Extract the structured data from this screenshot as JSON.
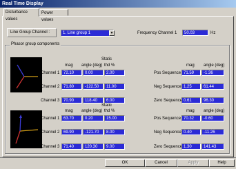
{
  "window": {
    "title": "Real Time Display"
  },
  "tabs": [
    {
      "label": "Disturbance values",
      "active": true
    },
    {
      "label": "Power values",
      "active": false
    }
  ],
  "line_group": {
    "label": "Line Group Channel :",
    "selected": "1. Line group 1"
  },
  "frequency": {
    "label": "Frequency Channel 1",
    "value": "50.03",
    "unit": "Hz"
  },
  "phasor_group": {
    "title": "Phasor group components",
    "upper": {
      "static_label": "Static",
      "headers": {
        "mag": "mag",
        "angle": "angle (deg)",
        "thd": "thd %"
      },
      "seq_headers": {
        "mag": "mag",
        "angle": "angle (deg)"
      },
      "channels": [
        {
          "label": "Channel 1",
          "mag": "72.10",
          "angle": "0.00",
          "thd": "2.00"
        },
        {
          "label": "Channel 2",
          "mag": "71.80",
          "angle": "-122.50",
          "thd": "11.00"
        },
        {
          "label": "Channel 3",
          "mag": "70.90",
          "angle": "118.40",
          "thd": "6.00"
        }
      ],
      "sequences": [
        {
          "label": "Pos Sequence",
          "mag": "71.59",
          "angle": "-1.36"
        },
        {
          "label": "Neg Sequence",
          "mag": "1.25",
          "angle": "61.44"
        },
        {
          "label": "Zero Sequence",
          "mag": "0.61",
          "angle": "96.30"
        }
      ]
    },
    "lower": {
      "static_label": "Static",
      "headers": {
        "mag": "mag",
        "angle": "angle (deg)",
        "thd": "thd %"
      },
      "seq_headers": {
        "mag": "mag",
        "angle": "angle (deg)"
      },
      "channels": [
        {
          "label": "Channel 1",
          "mag": "63.70",
          "angle": "0.20",
          "thd": "15.00"
        },
        {
          "label": "Channel 2",
          "mag": "69.90",
          "angle": "-121.70",
          "thd": "8.00"
        },
        {
          "label": "Channel 3",
          "mag": "71.40",
          "angle": "120.30",
          "thd": "9.00"
        }
      ],
      "sequences": [
        {
          "label": "Pos Sequence",
          "mag": "70.32",
          "angle": "-0.60"
        },
        {
          "label": "Neg Sequence",
          "mag": "0.40",
          "angle": "-11.26"
        },
        {
          "label": "Zero Sequence",
          "mag": "1.30",
          "angle": "141.43"
        }
      ]
    }
  },
  "buttons": {
    "ok": "OK",
    "cancel": "Cancel",
    "apply": "Apply",
    "help": "Help"
  },
  "colors": {
    "value_bg": "#2b2bd6",
    "phasor_1": "#d4a017",
    "phasor_2": "#cc3333",
    "phasor_3": "#3b3bd6"
  }
}
